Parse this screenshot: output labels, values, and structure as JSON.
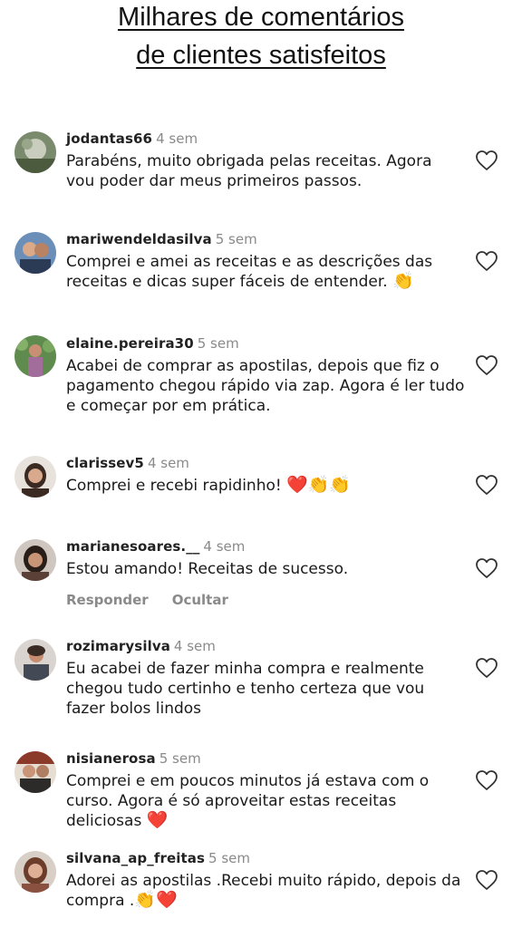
{
  "header": {
    "title_line1": "Milhares de  comentários",
    "title_line2": "de clientes satisfeitos"
  },
  "comments": [
    {
      "username": "jodantas66",
      "time": "4 sem",
      "text": "Parabéns, muito obrigada pelas receitas. Agora vou poder dar meus primeiros passos.",
      "avatar": "avatar-photo-1"
    },
    {
      "username": "mariwendeldasilva",
      "time": "5 sem",
      "text": "Comprei e amei as receitas e as descrições das receitas e dicas super fáceis de entender.",
      "emoji": "👏",
      "avatar": "avatar-photo-2"
    },
    {
      "username": "elaine.pereira30",
      "time": "5 sem",
      "text": "Acabei de comprar as apostilas, depois que fiz o pagamento chegou rápido via zap. Agora é ler tudo e começar por em prática.",
      "avatar": "avatar-photo-3"
    },
    {
      "username": "clarissev5",
      "time": "4 sem",
      "text": "Comprei e recebi rapidinho!",
      "emoji": "❤️👏👏",
      "avatar": "avatar-photo-4"
    },
    {
      "username": "marianesoares.__",
      "time": "4 sem",
      "text": "Estou amando! Receitas de sucesso.",
      "reply_label": "Responder",
      "hide_label": "Ocultar",
      "avatar": "avatar-photo-5"
    },
    {
      "username": "rozimarysilva",
      "time": "4 sem",
      "text": "Eu acabei de fazer minha compra e realmente chegou tudo certinho e tenho certeza que vou fazer bolos lindos",
      "avatar": "avatar-photo-6"
    },
    {
      "username": "nisianerosa",
      "time": "5 sem",
      "text": "Comprei e em poucos minutos já estava com o curso. Agora é só aproveitar estas receitas deliciosas",
      "emoji": "❤️",
      "avatar": "avatar-photo-7"
    },
    {
      "username": "silvana_ap_freitas",
      "time": "5 sem",
      "text": "Adorei as apostilas .Recebi muito rápido, depois da compra .",
      "emoji": "👏❤️",
      "avatar": "avatar-photo-8"
    }
  ],
  "icons": {
    "like": "heart-outline-icon"
  },
  "colors": {
    "text": "#1a1a1a",
    "muted": "#8a8a8a",
    "heart": "#e0242e"
  }
}
